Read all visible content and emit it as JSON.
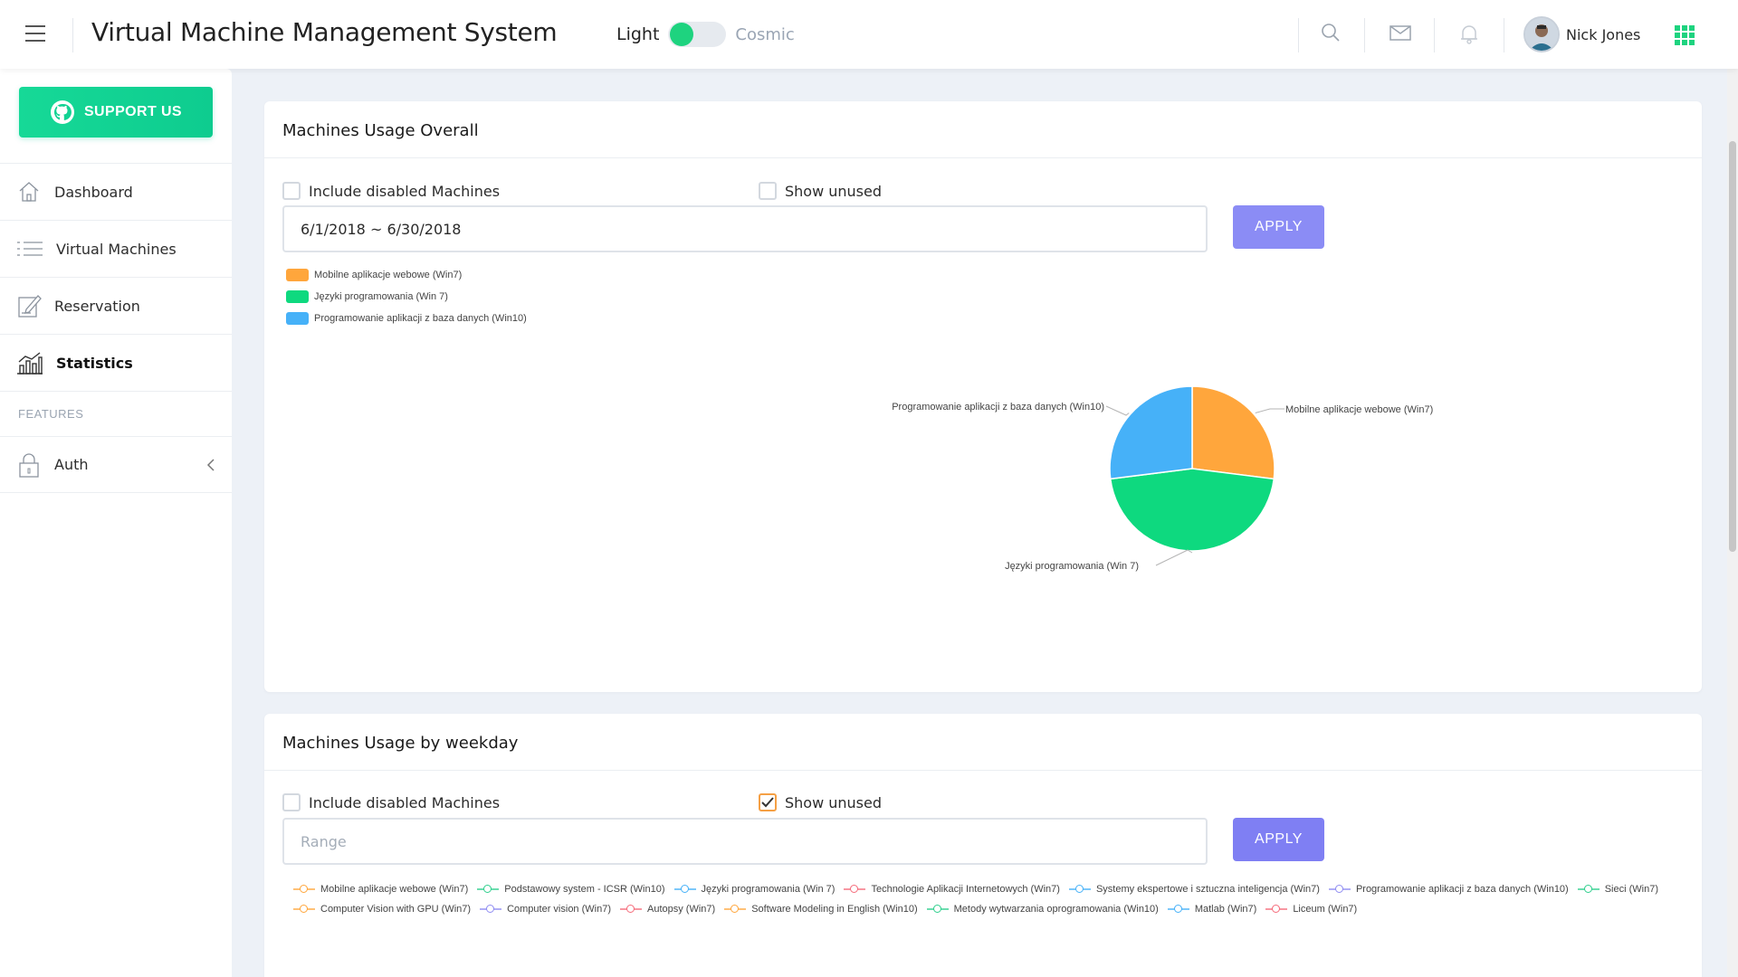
{
  "header": {
    "title": "Virtual Machine Management System",
    "theme_light": "Light",
    "theme_cosmic": "Cosmic",
    "user_name": "Nick Jones",
    "icons": [
      "menu-icon",
      "search-icon",
      "mail-icon",
      "bell-icon",
      "apps-grid-icon"
    ]
  },
  "sidebar": {
    "support_label": "SUPPORT US",
    "items": [
      {
        "label": "Dashboard",
        "icon": "home-icon"
      },
      {
        "label": "Virtual Machines",
        "icon": "list-icon"
      },
      {
        "label": "Reservation",
        "icon": "edit-icon"
      },
      {
        "label": "Statistics",
        "icon": "bar-chart-icon",
        "active": true
      }
    ],
    "section_label": "FEATURES",
    "auth_label": "Auth"
  },
  "overall": {
    "title": "Machines Usage Overall",
    "include_disabled_label": "Include disabled Machines",
    "show_unused_label": "Show unused",
    "include_disabled_checked": false,
    "show_unused_checked": false,
    "date_value": "6/1/2018 ~ 6/30/2018",
    "apply_label": "APPLY"
  },
  "weekday": {
    "title": "Machines Usage by weekday",
    "include_disabled_label": "Include disabled Machines",
    "show_unused_label": "Show unused",
    "include_disabled_checked": false,
    "show_unused_checked": true,
    "range_placeholder": "Range",
    "apply_label": "APPLY"
  },
  "colors": {
    "accent": "#1ed37f",
    "apply": "#8b8cf5",
    "orange": "#ffa63c",
    "green": "#0ed97f",
    "blue": "#46b1f8"
  },
  "chart_data": [
    {
      "type": "pie",
      "title": "",
      "legend_placement": "top-left",
      "slices": [
        {
          "label": "Mobilne aplikacje webowe (Win7)",
          "value": 27,
          "color": "#ffa63c"
        },
        {
          "label": "Języki programowania (Win 7)",
          "value": 46,
          "color": "#0ed97f"
        },
        {
          "label": "Programowanie aplikacji z baza danych (Win10)",
          "value": 27,
          "color": "#46b1f8"
        }
      ]
    },
    {
      "type": "line",
      "title": "",
      "legend_placement": "top",
      "series": [
        {
          "name": "Mobilne aplikacje webowe (Win7)",
          "color": "#ffa63c"
        },
        {
          "name": "Podstawowy system - ICSR (Win10)",
          "color": "#2ecf8d"
        },
        {
          "name": "Języki programowania (Win 7)",
          "color": "#46b1f8"
        },
        {
          "name": "Technologie Aplikacji Internetowych (Win7)",
          "color": "#f56b7a"
        },
        {
          "name": "Systemy ekspertowe i sztuczna inteligencja (Win7)",
          "color": "#46b1f8"
        },
        {
          "name": "Programowanie aplikacji z baza danych (Win10)",
          "color": "#8f8cf2"
        },
        {
          "name": "Sieci (Win7)",
          "color": "#2ecf8d"
        },
        {
          "name": "Computer Vision with GPU (Win7)",
          "color": "#ffa63c"
        },
        {
          "name": "Computer vision (Win7)",
          "color": "#8f8cf2"
        },
        {
          "name": "Autopsy (Win7)",
          "color": "#f56b7a"
        },
        {
          "name": "Software Modeling in English (Win10)",
          "color": "#ffa63c"
        },
        {
          "name": "Metody wytwarzania oprogramowania (Win10)",
          "color": "#2ecf8d"
        },
        {
          "name": "Matlab (Win7)",
          "color": "#46b1f8"
        },
        {
          "name": "Liceum (Win7)",
          "color": "#f56b7a"
        }
      ]
    }
  ]
}
